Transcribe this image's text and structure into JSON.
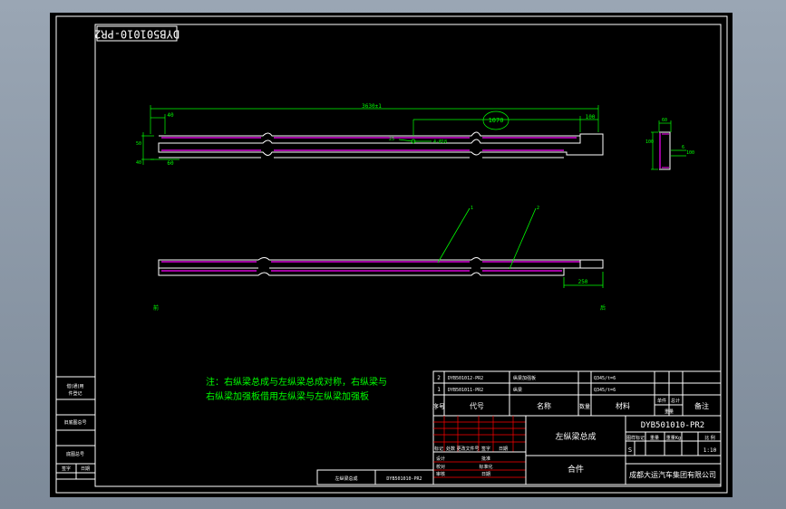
{
  "drawing": {
    "corner_code": "DYB501010-PR2",
    "colors": {
      "background": "#000000",
      "frame": "#ffffff",
      "dimension": "#00ff00",
      "beam_outline": "#ffffff",
      "beam_inner": "#ff00ff",
      "table_red": "#ff0000"
    }
  },
  "top_view": {
    "dims": {
      "overall": "3630±1",
      "left_offset": "40",
      "center_section": "1070",
      "right_offset": "100",
      "height_top": "50",
      "height_bottom": "40",
      "left_bottom": "60",
      "hole_mark": "4-Ø18",
      "hole_label": "25"
    }
  },
  "section_view": {
    "dims": {
      "width": "60",
      "height": "100",
      "side_a": "6",
      "side_b": "100"
    }
  },
  "bottom_view": {
    "callouts": [
      "1",
      "2"
    ],
    "right_dim": "250"
  },
  "side_marks": {
    "left": "前",
    "right": "后"
  },
  "note": {
    "line1": "注：右纵梁总成与左纵梁总成对称，右纵梁与",
    "line2": "右纵梁加强板借用左纵梁与左纵梁加强板"
  },
  "revision_block": {
    "rows": [
      "借(通)用",
      "件登记",
      "旧底图总号",
      "底图总号",
      "签字",
      "日期"
    ]
  },
  "bom": {
    "rows": [
      {
        "no": "2",
        "code": "DYB501012-PR2",
        "name": "纵梁加强板",
        "material": "Q345/t=6"
      },
      {
        "no": "1",
        "code": "DYB501011-PR2",
        "name": "纵梁",
        "material": "Q345/t=6"
      }
    ],
    "header": {
      "no": "序号",
      "code": "代号",
      "name": "名称",
      "qty": "数量",
      "material": "材料",
      "unit_weight": "单件",
      "total_weight": "总计",
      "weight": "重量",
      "remark": "备注"
    }
  },
  "title_block": {
    "drawing_no": "DYB501010-PR2",
    "part_name": "左纵梁总成",
    "phase_labels": [
      "图样标记",
      "重量",
      "重量Kg"
    ],
    "mark": "S",
    "scale_label": "比 例",
    "scale": "1:10",
    "assembly": "合件",
    "company": "成都大运汽车集团有限公司",
    "rows": [
      "标记",
      "处数",
      "更改文件号",
      "签字",
      "日期"
    ],
    "roles": [
      "设计",
      "校对",
      "审核",
      "批准",
      "标准化",
      "日期"
    ]
  },
  "stamp": {
    "left": "左纵梁总成",
    "right": "DYB501010-PR2"
  }
}
